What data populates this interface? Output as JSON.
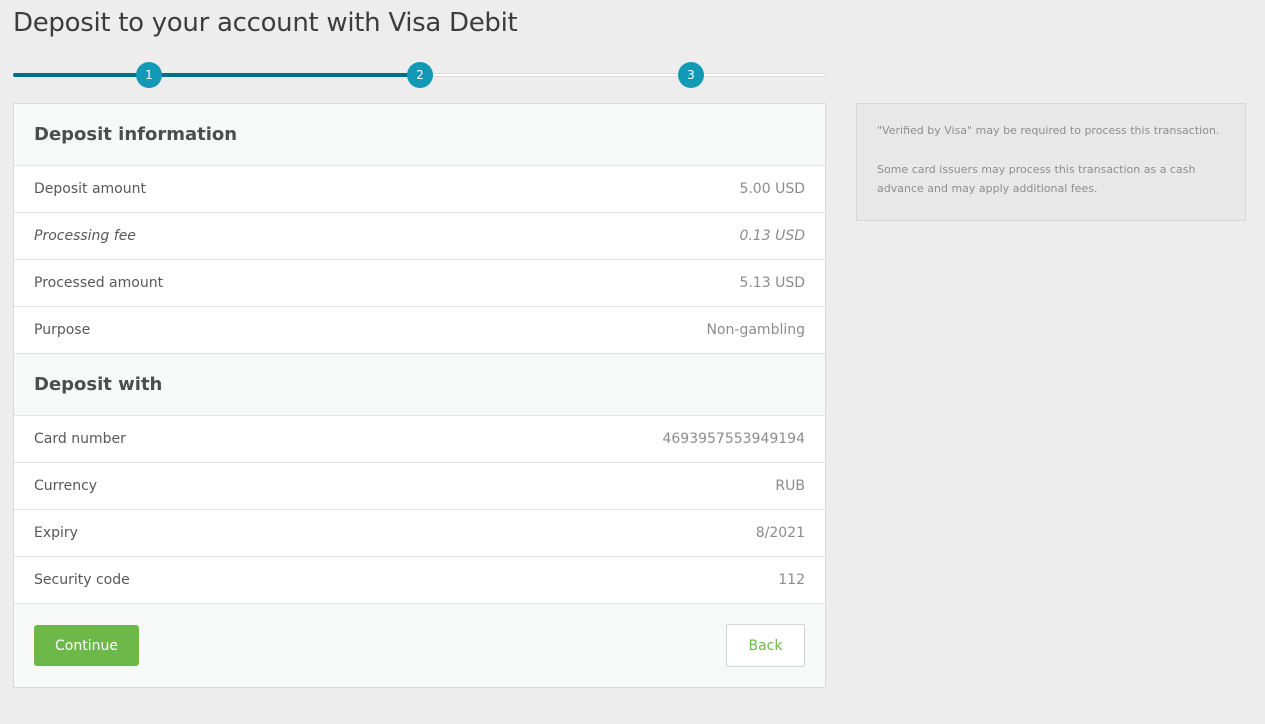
{
  "page": {
    "title": "Deposit to your account with Visa Debit"
  },
  "stepper": {
    "steps": [
      "1",
      "2",
      "3"
    ],
    "current_step": 2,
    "progress": 0.5,
    "colors": {
      "completed_track": "#006d91",
      "step_circle": "#1299b6"
    }
  },
  "deposit_information": {
    "heading": "Deposit information",
    "rows": [
      {
        "label": "Deposit amount",
        "value": "5.00 USD"
      },
      {
        "label": "Processing fee",
        "value": "0.13 USD"
      },
      {
        "label": "Processed amount",
        "value": "5.13 USD"
      },
      {
        "label": "Purpose",
        "value": "Non-gambling"
      }
    ]
  },
  "deposit_with": {
    "heading": "Deposit with",
    "rows": [
      {
        "label": "Card number",
        "value": "4693957553949194"
      },
      {
        "label": "Currency",
        "value": "RUB"
      },
      {
        "label": "Expiry",
        "value": "8/2021"
      },
      {
        "label": "Security code",
        "value": "112"
      }
    ]
  },
  "actions": {
    "continue_label": "Continue",
    "back_label": "Back",
    "accent_color": "#6cb94a"
  },
  "notice": {
    "line1": "\"Verified by Visa\" may be required to process this transaction.",
    "line2": "Some card issuers may process this transaction as a cash advance and may apply additional fees."
  }
}
